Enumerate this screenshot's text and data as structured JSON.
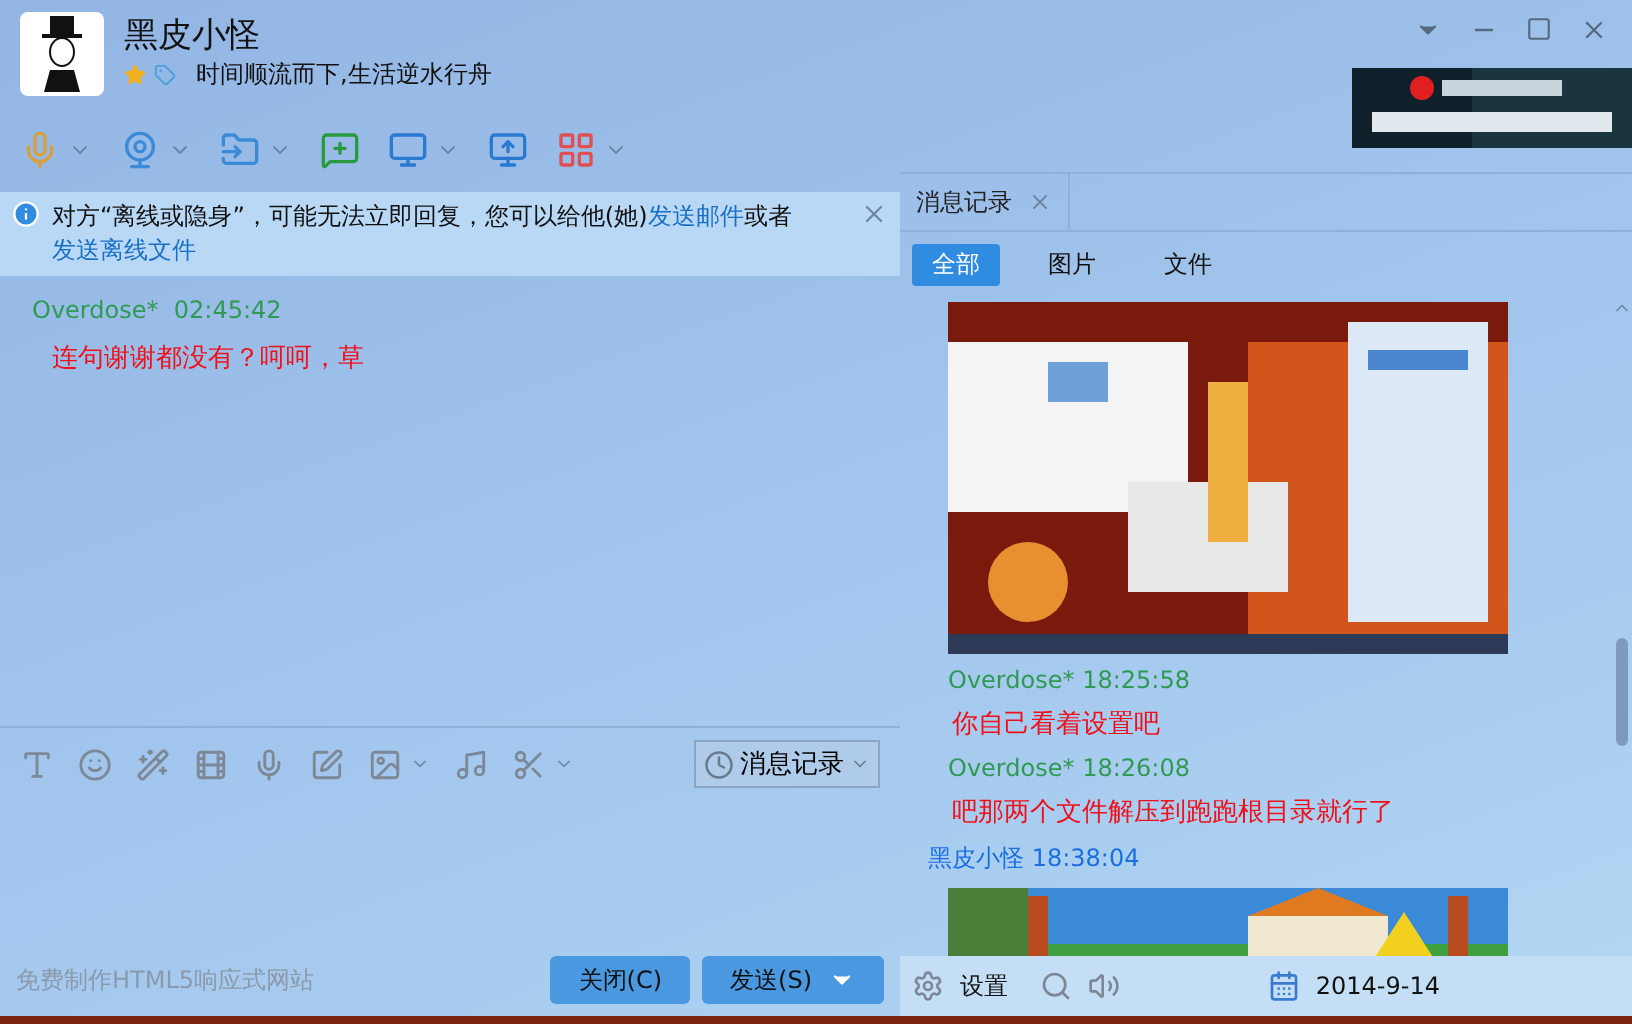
{
  "window": {
    "title": "黑皮小怪",
    "signature": "时间顺流而下,生活逆水行舟"
  },
  "notice": {
    "parts": [
      {
        "kind": "plain",
        "text": "对方“离线或隐身”，可能无法立即回复，您可以给他(她)"
      },
      {
        "kind": "link",
        "text": "发送邮件"
      },
      {
        "kind": "plain",
        "text": "或者"
      },
      {
        "kind": "link",
        "text": "发送离线文件"
      }
    ]
  },
  "chat": [
    {
      "sender": "Overdose*",
      "time": "02:45:42",
      "text": "连句谢谢都没有？呵呵，草"
    }
  ],
  "input": {
    "history_button": "消息记录",
    "footer_link": "免费制作HTML5响应式网站",
    "buttons": [
      {
        "kind": "plain",
        "label": "关闭(C)"
      },
      {
        "kind": "split",
        "label": "发送(S)"
      }
    ]
  },
  "history": {
    "tab": "消息记录",
    "filters": [
      {
        "label": "全部",
        "selected": true
      },
      {
        "label": "图片",
        "selected": false
      },
      {
        "label": "文件",
        "selected": false
      }
    ],
    "items": [
      {
        "kind": "picture"
      },
      {
        "kind": "meta",
        "sender": "Overdose*",
        "time": "18:25:58",
        "self": false
      },
      {
        "kind": "text",
        "text": "你自己看着设置吧"
      },
      {
        "kind": "meta",
        "sender": "Overdose*",
        "time": "18:26:08",
        "self": false
      },
      {
        "kind": "text",
        "text": "吧那两个文件解压到跑跑根目录就行了"
      },
      {
        "kind": "meta",
        "sender": "黑皮小怪",
        "time": "18:38:04",
        "self": true
      },
      {
        "kind": "picture"
      }
    ],
    "settings": "设置",
    "date": "2014-9-14"
  }
}
